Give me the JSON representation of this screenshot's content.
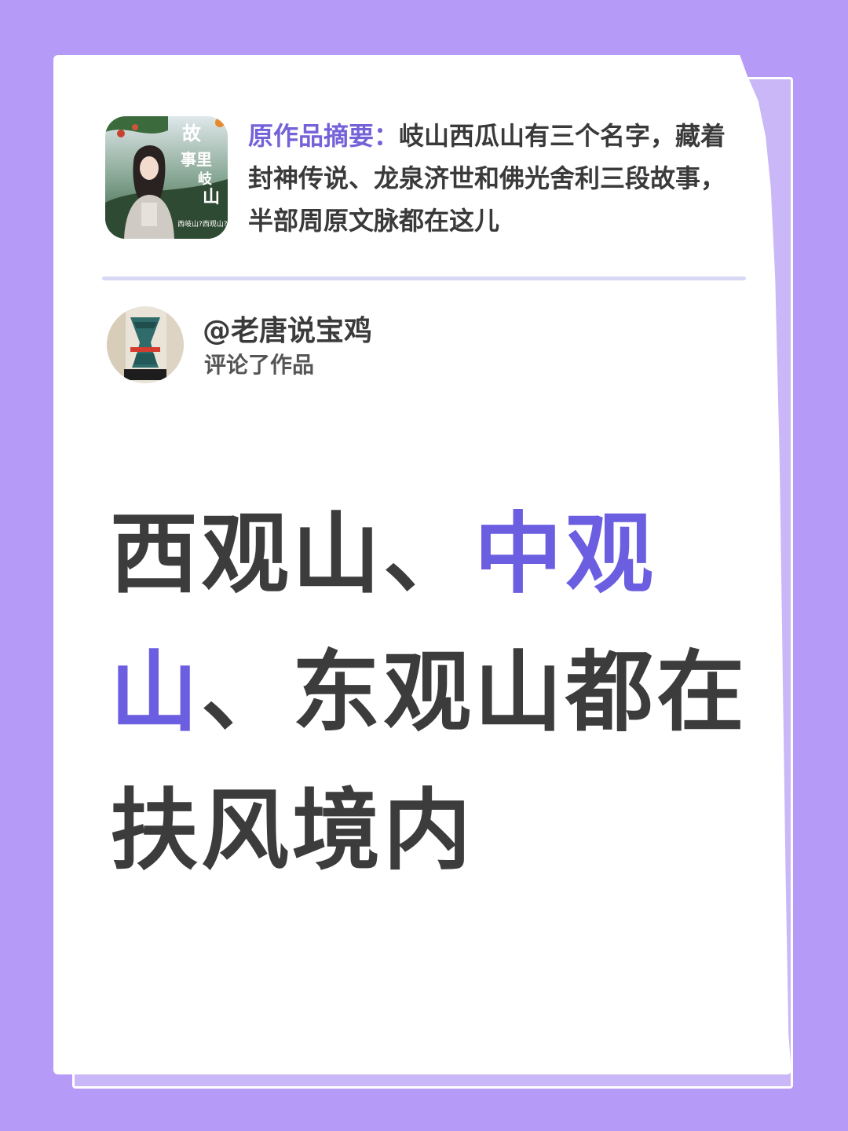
{
  "original": {
    "thumbnail_icon": "video-thumbnail-portrait",
    "thumbnail_caption_chars": "故事里的岐山",
    "thumbnail_subcaption": "西岐山?西观山?",
    "summary_label": "原作品摘要：",
    "summary_text": "岐山西瓜山有三个名字，藏着封神传说、龙泉济世和佛光舍利三段故事，半部周原文脉都在这儿"
  },
  "comment": {
    "avatar_icon": "bronze-vessel-avatar",
    "handle": "@老唐说宝鸡",
    "action": "评论了作品"
  },
  "headline": {
    "part1": "西观山、",
    "part2": "中观山",
    "part3": "、东观山都在扶风境内"
  },
  "colors": {
    "background": "#b69af8",
    "accent": "#6c5ee0",
    "text": "#3c3c3c"
  }
}
